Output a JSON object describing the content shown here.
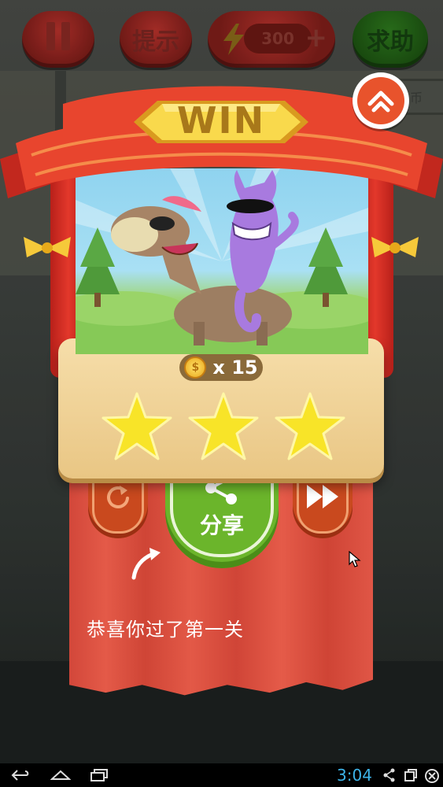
{
  "topbar": {
    "hint_label": "提示",
    "energy_value": "300",
    "energy_plus": "+",
    "help_label": "求助"
  },
  "background": {
    "sign_text": "币"
  },
  "result": {
    "title": "WIN",
    "coin_reward": "x 15",
    "coin_symbol": "$",
    "stars_earned": 3,
    "stars_total": 3
  },
  "actions": {
    "share_label": "分享"
  },
  "message": "恭喜你过了第一关",
  "statusbar": {
    "clock": "3:04"
  },
  "colors": {
    "banner_red": "#e8452e",
    "win_gold": "#f6d24a",
    "share_green": "#6bb52b",
    "curtain_red": "#d94c3b",
    "clock_blue": "#3db3e8"
  },
  "icons": [
    "pause-icon",
    "lightning-icon",
    "home-icon",
    "coin-icon",
    "star-icon",
    "replay-icon",
    "share-icon",
    "fast-forward-icon",
    "hand-arrow-icon",
    "back-icon",
    "home-nav-icon",
    "recents-icon",
    "share-nav-icon",
    "screen-icon",
    "close-circle-icon",
    "cursor-icon"
  ]
}
